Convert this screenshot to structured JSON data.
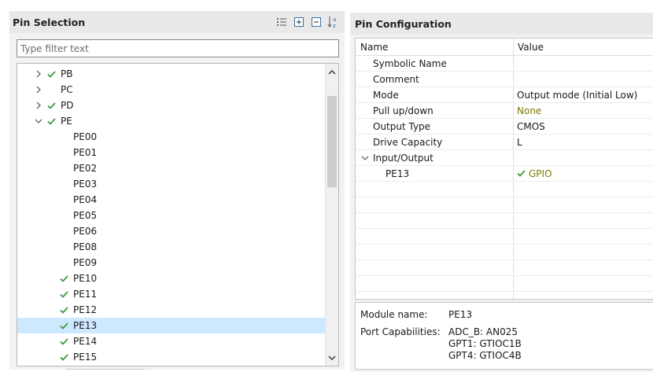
{
  "pin_selection": {
    "title": "Pin Selection",
    "filter_placeholder": "Type filter text",
    "tree": [
      {
        "label": "PB",
        "expander": "collapsed",
        "checked": true,
        "level": 0
      },
      {
        "label": "PC",
        "expander": "collapsed",
        "checked": false,
        "level": 0
      },
      {
        "label": "PD",
        "expander": "collapsed",
        "checked": true,
        "level": 0
      },
      {
        "label": "PE",
        "expander": "expanded",
        "checked": true,
        "level": 0
      },
      {
        "label": "PE00",
        "checked": false,
        "level": 1
      },
      {
        "label": "PE01",
        "checked": false,
        "level": 1
      },
      {
        "label": "PE02",
        "checked": false,
        "level": 1
      },
      {
        "label": "PE03",
        "checked": false,
        "level": 1
      },
      {
        "label": "PE04",
        "checked": false,
        "level": 1
      },
      {
        "label": "PE05",
        "checked": false,
        "level": 1
      },
      {
        "label": "PE06",
        "checked": false,
        "level": 1
      },
      {
        "label": "PE08",
        "checked": false,
        "level": 1
      },
      {
        "label": "PE09",
        "checked": false,
        "level": 1
      },
      {
        "label": "PE10",
        "checked": true,
        "level": 1
      },
      {
        "label": "PE11",
        "checked": true,
        "level": 1
      },
      {
        "label": "PE12",
        "checked": true,
        "level": 1
      },
      {
        "label": "PE13",
        "checked": true,
        "level": 1,
        "selected": true
      },
      {
        "label": "PE14",
        "checked": true,
        "level": 1
      },
      {
        "label": "PE15",
        "checked": true,
        "level": 1
      }
    ],
    "toolbar_icons": [
      "show-list-icon",
      "expand-all-icon",
      "collapse-all-icon",
      "sort-alpha-icon"
    ]
  },
  "pin_configuration": {
    "title": "Pin Configuration",
    "columns": {
      "name": "Name",
      "value": "Value"
    },
    "rows": [
      {
        "name": "Symbolic Name",
        "value": ""
      },
      {
        "name": "Comment",
        "value": ""
      },
      {
        "name": "Mode",
        "value": "Output mode (Initial Low)"
      },
      {
        "name": "Pull up/down",
        "value": "None",
        "olive": true
      },
      {
        "name": "Output Type",
        "value": "CMOS"
      },
      {
        "name": "Drive Capacity",
        "value": "L"
      },
      {
        "name": "Input/Output",
        "value": "",
        "group": true
      },
      {
        "name": "PE13",
        "value": "GPIO",
        "child": true,
        "checked": true,
        "olive": true
      }
    ],
    "module_name_label": "Module name:",
    "module_name_value": "PE13",
    "port_capabilities_label": "Port Capabilities:",
    "port_capabilities": [
      "ADC_B: AN025",
      "GPT1: GTIOC1B",
      "GPT4: GTIOC4B"
    ]
  },
  "colors": {
    "check_green": "#3c9a3c",
    "olive_value": "#7f7a00",
    "selection": "#cde8ff"
  }
}
